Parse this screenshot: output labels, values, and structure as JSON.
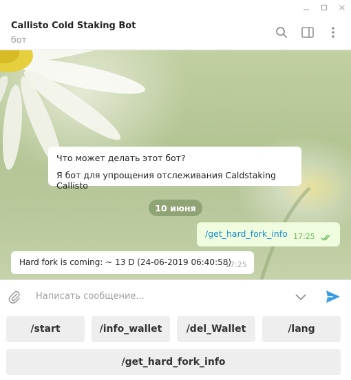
{
  "chat": {
    "title": "Callisto Cold Staking Bot",
    "subtitle": "бот"
  },
  "intro": {
    "title": "Что может делать этот бот?",
    "text": "Я бот для упрощения отслеживания Caldstaking Callisto"
  },
  "date_badge": "10 июня",
  "messages": [
    {
      "direction": "outgoing",
      "text": "/get_hard_fork_info",
      "time": "17:25",
      "status_icon": "double-check-icon"
    },
    {
      "direction": "incoming",
      "text": "Hard fork is coming: ~ 13 D (24-06-2019  06:40:58)",
      "time": "17:25"
    }
  ],
  "composer": {
    "placeholder": "Написать сообщение...",
    "left_icon": "paperclip-icon",
    "right_icons": [
      "chevron-down-icon",
      "send-icon"
    ]
  },
  "keyboard": {
    "rows": [
      [
        "/start",
        "/info_wallet",
        "/del_Wallet",
        "/lang"
      ],
      [
        "/get_hard_fork_info"
      ]
    ]
  },
  "header_icons": [
    "search-icon",
    "sidebar-toggle-icon",
    "more-vertical-icon"
  ],
  "window_controls": [
    "minimize-icon",
    "maximize-icon",
    "close-icon"
  ],
  "colors": {
    "link": "#1a8ad1",
    "outgoing_bubble": "#effdde",
    "send": "#3a9ce2",
    "read_check": "#6cbc5c"
  }
}
